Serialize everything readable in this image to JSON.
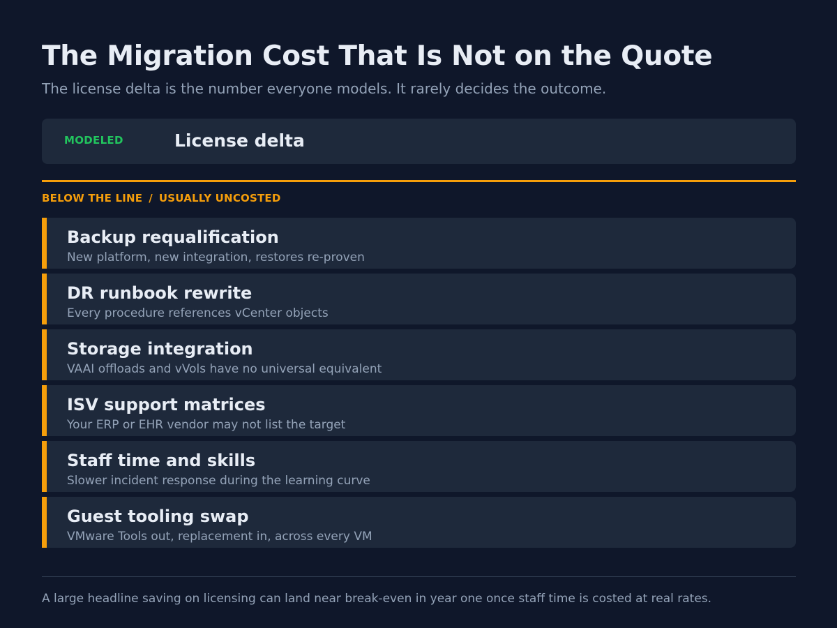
{
  "header": {
    "title": "The Migration Cost That Is Not on the Quote",
    "subtitle": "The license delta is the number everyone models. It rarely decides the outcome."
  },
  "modeled": {
    "tag": "MODELED",
    "label": "License delta"
  },
  "below_line": {
    "heading_left": "BELOW THE LINE",
    "separator": "/",
    "heading_right": "USUALLY UNCOSTED",
    "items": [
      {
        "title": "Backup requalification",
        "description": "New platform, new integration, restores re-proven"
      },
      {
        "title": "DR runbook rewrite",
        "description": "Every procedure references vCenter objects"
      },
      {
        "title": "Storage integration",
        "description": "VAAI offloads and vVols have no universal equivalent"
      },
      {
        "title": "ISV support matrices",
        "description": "Your ERP or EHR vendor may not list the target"
      },
      {
        "title": "Staff time and skills",
        "description": "Slower incident response during the learning curve"
      },
      {
        "title": "Guest tooling swap",
        "description": "VMware Tools out, replacement in, across every VM"
      }
    ]
  },
  "footer": {
    "note": "A large headline saving on licensing can land near break-even in year one once staff time is costed at real rates."
  },
  "colors": {
    "background": "#0f172a",
    "card": "#1e293b",
    "accent_modeled": "#22c55e",
    "accent_uncosted": "#f59e0b",
    "text_primary": "#e8edf5",
    "text_muted": "#94a3b8"
  }
}
